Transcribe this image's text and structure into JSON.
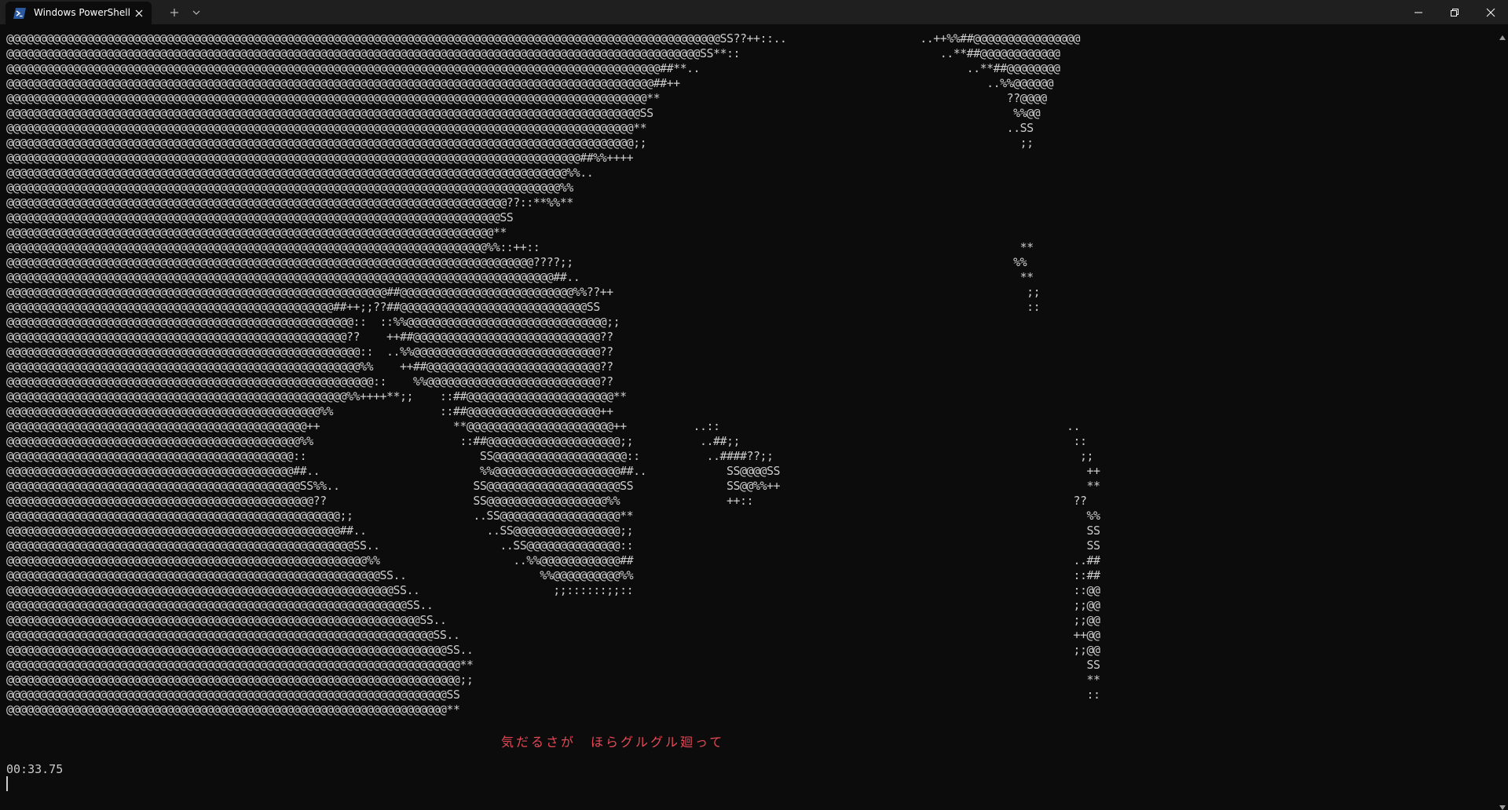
{
  "window": {
    "tab_title": "Windows PowerShell",
    "tab_icon": "powershell-icon",
    "close_tab_icon": "close-icon",
    "new_tab_icon": "plus-icon",
    "dropdown_icon": "chevron-down-icon",
    "minimize_icon": "minimize-icon",
    "maximize_icon": "restore-icon",
    "close_window_icon": "close-icon"
  },
  "colors": {
    "background": "#0c0c0c",
    "titlebar": "#1f1f1f",
    "text": "#cccccc",
    "lyrics": "#e74856",
    "powershell_blue": "#2c5aa0"
  },
  "terminal": {
    "ascii_lines": [
      "@@@@@@@@@@@@@@@@@@@@@@@@@@@@@@@@@@@@@@@@@@@@@@@@@@@@@@@@@@@@@@@@@@@@@@@@@@@@@@@@@@@@@@@@@@@@@@@@@@@@@@@@@@@SS??++::..                    ..++%%##@@@@@@@@@@@@@@@@",
      "@@@@@@@@@@@@@@@@@@@@@@@@@@@@@@@@@@@@@@@@@@@@@@@@@@@@@@@@@@@@@@@@@@@@@@@@@@@@@@@@@@@@@@@@@@@@@@@@@@@@@@@@SS**::                              ..**##@@@@@@@@@@@@",
      "@@@@@@@@@@@@@@@@@@@@@@@@@@@@@@@@@@@@@@@@@@@@@@@@@@@@@@@@@@@@@@@@@@@@@@@@@@@@@@@@@@@@@@@@@@@@@@@@@@##**..                                        ..**##@@@@@@@@",
      "@@@@@@@@@@@@@@@@@@@@@@@@@@@@@@@@@@@@@@@@@@@@@@@@@@@@@@@@@@@@@@@@@@@@@@@@@@@@@@@@@@@@@@@@@@@@@@@@@##++                                              ..%%@@@@@@",
      "@@@@@@@@@@@@@@@@@@@@@@@@@@@@@@@@@@@@@@@@@@@@@@@@@@@@@@@@@@@@@@@@@@@@@@@@@@@@@@@@@@@@@@@@@@@@@@@@**                                                    ??@@@@",
      "@@@@@@@@@@@@@@@@@@@@@@@@@@@@@@@@@@@@@@@@@@@@@@@@@@@@@@@@@@@@@@@@@@@@@@@@@@@@@@@@@@@@@@@@@@@@@@@SS                                                      %%@@",
      "@@@@@@@@@@@@@@@@@@@@@@@@@@@@@@@@@@@@@@@@@@@@@@@@@@@@@@@@@@@@@@@@@@@@@@@@@@@@@@@@@@@@@@@@@@@@@@**                                                      ..SS",
      "@@@@@@@@@@@@@@@@@@@@@@@@@@@@@@@@@@@@@@@@@@@@@@@@@@@@@@@@@@@@@@@@@@@@@@@@@@@@@@@@@@@@@@@@@@@@@@;;                                                        ;;",
      "@@@@@@@@@@@@@@@@@@@@@@@@@@@@@@@@@@@@@@@@@@@@@@@@@@@@@@@@@@@@@@@@@@@@@@@@@@@@@@@@@@@@@@##%%++++",
      "@@@@@@@@@@@@@@@@@@@@@@@@@@@@@@@@@@@@@@@@@@@@@@@@@@@@@@@@@@@@@@@@@@@@@@@@@@@@@@@@@@@@%%..",
      "@@@@@@@@@@@@@@@@@@@@@@@@@@@@@@@@@@@@@@@@@@@@@@@@@@@@@@@@@@@@@@@@@@@@@@@@@@@@@@@@@@@%%",
      "@@@@@@@@@@@@@@@@@@@@@@@@@@@@@@@@@@@@@@@@@@@@@@@@@@@@@@@@@@@@@@@@@@@@@@@@@@@??::**%%**",
      "@@@@@@@@@@@@@@@@@@@@@@@@@@@@@@@@@@@@@@@@@@@@@@@@@@@@@@@@@@@@@@@@@@@@@@@@@@SS",
      "@@@@@@@@@@@@@@@@@@@@@@@@@@@@@@@@@@@@@@@@@@@@@@@@@@@@@@@@@@@@@@@@@@@@@@@@@**",
      "@@@@@@@@@@@@@@@@@@@@@@@@@@@@@@@@@@@@@@@@@@@@@@@@@@@@@@@@@@@@@@@@@@@@@@@@%%::++::                                                                        **",
      "@@@@@@@@@@@@@@@@@@@@@@@@@@@@@@@@@@@@@@@@@@@@@@@@@@@@@@@@@@@@@@@@@@@@@@@@@@@@@@@????;;                                                                  %%",
      "@@@@@@@@@@@@@@@@@@@@@@@@@@@@@@@@@@@@@@@@@@@@@@@@@@@@@@@@@@@@@@@@@@@@@@@@@@@@@@@@@@##..                                                                  **",
      "@@@@@@@@@@@@@@@@@@@@@@@@@@@@@@@@@@@@@@@@@@@@@@@@@@@@@@@@@##@@@@@@@@@@@@@@@@@@@@@@@@@@%%??++                                                              ;;",
      "@@@@@@@@@@@@@@@@@@@@@@@@@@@@@@@@@@@@@@@@@@@@@@@@@##++;;??##@@@@@@@@@@@@@@@@@@@@@@@@@@@@SS                                                                ::",
      "@@@@@@@@@@@@@@@@@@@@@@@@@@@@@@@@@@@@@@@@@@@@@@@@@@@@::  ::%%@@@@@@@@@@@@@@@@@@@@@@@@@@@@@@;;",
      "@@@@@@@@@@@@@@@@@@@@@@@@@@@@@@@@@@@@@@@@@@@@@@@@@@@??    ++##@@@@@@@@@@@@@@@@@@@@@@@@@@@@??",
      "@@@@@@@@@@@@@@@@@@@@@@@@@@@@@@@@@@@@@@@@@@@@@@@@@@@@@::  ..%%@@@@@@@@@@@@@@@@@@@@@@@@@@@@??",
      "@@@@@@@@@@@@@@@@@@@@@@@@@@@@@@@@@@@@@@@@@@@@@@@@@@@@@%%    ++##@@@@@@@@@@@@@@@@@@@@@@@@@@??",
      "@@@@@@@@@@@@@@@@@@@@@@@@@@@@@@@@@@@@@@@@@@@@@@@@@@@@@@@::    %%@@@@@@@@@@@@@@@@@@@@@@@@@@??",
      "@@@@@@@@@@@@@@@@@@@@@@@@@@@@@@@@@@@@@@@@@@@@@@@@@@@%%++++**;;    ::##@@@@@@@@@@@@@@@@@@@@@@**",
      "@@@@@@@@@@@@@@@@@@@@@@@@@@@@@@@@@@@@@@@@@@@@@@@%%                ::##@@@@@@@@@@@@@@@@@@@@++",
      "@@@@@@@@@@@@@@@@@@@@@@@@@@@@@@@@@@@@@@@@@@@@@++                    **@@@@@@@@@@@@@@@@@@@@@@++          ..::                                                    ..",
      "@@@@@@@@@@@@@@@@@@@@@@@@@@@@@@@@@@@@@@@@@@@@%%                      ::##@@@@@@@@@@@@@@@@@@@@;;          ..##;;                                                  ::",
      "@@@@@@@@@@@@@@@@@@@@@@@@@@@@@@@@@@@@@@@@@@@::                          SS@@@@@@@@@@@@@@@@@@@@::          ..####??;;                                              ;;",
      "@@@@@@@@@@@@@@@@@@@@@@@@@@@@@@@@@@@@@@@@@@@##..                        %%@@@@@@@@@@@@@@@@@@@##..            SS@@@@SS                                              ++",
      "@@@@@@@@@@@@@@@@@@@@@@@@@@@@@@@@@@@@@@@@@@@@SS%%..                    SS@@@@@@@@@@@@@@@@@@@@SS              SS@@%%++                                              **",
      "@@@@@@@@@@@@@@@@@@@@@@@@@@@@@@@@@@@@@@@@@@@@@@??                      SS@@@@@@@@@@@@@@@@@@%%                ++::                                                ??",
      "@@@@@@@@@@@@@@@@@@@@@@@@@@@@@@@@@@@@@@@@@@@@@@@@@@;;                  ..SS@@@@@@@@@@@@@@@@@@**                                                                    %%",
      "@@@@@@@@@@@@@@@@@@@@@@@@@@@@@@@@@@@@@@@@@@@@@@@@@@##..                  ..SS@@@@@@@@@@@@@@@@;;                                                                    SS",
      "@@@@@@@@@@@@@@@@@@@@@@@@@@@@@@@@@@@@@@@@@@@@@@@@@@@@SS..                  ..SS@@@@@@@@@@@@@@::                                                                    SS",
      "@@@@@@@@@@@@@@@@@@@@@@@@@@@@@@@@@@@@@@@@@@@@@@@@@@@@@@%%                    ..%%@@@@@@@@@@@@##                                                                  ..##",
      "@@@@@@@@@@@@@@@@@@@@@@@@@@@@@@@@@@@@@@@@@@@@@@@@@@@@@@@@SS..                    %%@@@@@@@@@@%%                                                                  ::##",
      "@@@@@@@@@@@@@@@@@@@@@@@@@@@@@@@@@@@@@@@@@@@@@@@@@@@@@@@@@@SS..                    ;;::::::;;::                                                                  ::@@",
      "@@@@@@@@@@@@@@@@@@@@@@@@@@@@@@@@@@@@@@@@@@@@@@@@@@@@@@@@@@@@SS..                                                                                                ;;@@",
      "@@@@@@@@@@@@@@@@@@@@@@@@@@@@@@@@@@@@@@@@@@@@@@@@@@@@@@@@@@@@@@SS..                                                                                              ;;@@",
      "@@@@@@@@@@@@@@@@@@@@@@@@@@@@@@@@@@@@@@@@@@@@@@@@@@@@@@@@@@@@@@@@SS..                                                                                            ++@@",
      "@@@@@@@@@@@@@@@@@@@@@@@@@@@@@@@@@@@@@@@@@@@@@@@@@@@@@@@@@@@@@@@@@@SS..                                                                                          ;;@@",
      "@@@@@@@@@@@@@@@@@@@@@@@@@@@@@@@@@@@@@@@@@@@@@@@@@@@@@@@@@@@@@@@@@@@@**                                                                                            SS",
      "@@@@@@@@@@@@@@@@@@@@@@@@@@@@@@@@@@@@@@@@@@@@@@@@@@@@@@@@@@@@@@@@@@@@;;                                                                                            **",
      "@@@@@@@@@@@@@@@@@@@@@@@@@@@@@@@@@@@@@@@@@@@@@@@@@@@@@@@@@@@@@@@@@@SS                                                                                              ::",
      "@@@@@@@@@@@@@@@@@@@@@@@@@@@@@@@@@@@@@@@@@@@@@@@@@@@@@@@@@@@@@@@@@@**"
    ],
    "lyrics": "気だるさが　ほらグルグル廻って",
    "timer": "00:33.75"
  },
  "scrollbar": {
    "up_icon": "scroll-up-arrow-icon",
    "down_icon": "scroll-down-arrow-icon"
  }
}
